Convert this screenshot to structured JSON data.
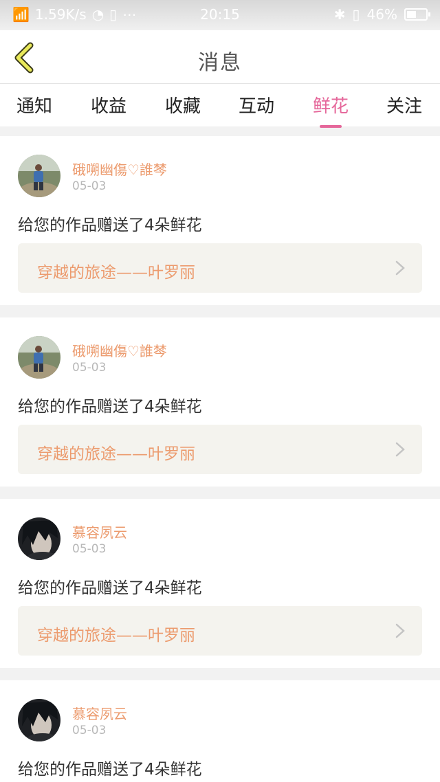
{
  "status_bar": {
    "network_speed": "1.59K/s",
    "time": "20:15",
    "battery": "46%"
  },
  "header": {
    "title": "消息"
  },
  "tabs": [
    {
      "label": "通知",
      "active": false
    },
    {
      "label": "收益",
      "active": false
    },
    {
      "label": "收藏",
      "active": false
    },
    {
      "label": "互动",
      "active": false
    },
    {
      "label": "鲜花",
      "active": true
    },
    {
      "label": "关注",
      "active": false
    }
  ],
  "colors": {
    "accent": "#e5679a",
    "username": "#ec9b6e",
    "link_bg": "#f4f3ee"
  },
  "messages": [
    {
      "username": "硪嗍幽傷♡誰棽",
      "date": "05-03",
      "text": "给您的作品赠送了4朵鲜花",
      "work_title": "穿越的旅途——叶罗丽",
      "avatar": "outdoor-photo-avatar"
    },
    {
      "username": "硪嗍幽傷♡誰棽",
      "date": "05-03",
      "text": "给您的作品赠送了4朵鲜花",
      "work_title": "穿越的旅途——叶罗丽",
      "avatar": "outdoor-photo-avatar"
    },
    {
      "username": "慕容夙云",
      "date": "05-03",
      "text": "给您的作品赠送了4朵鲜花",
      "work_title": "穿越的旅途——叶罗丽",
      "avatar": "anime-character-avatar"
    },
    {
      "username": "慕容夙云",
      "date": "05-03",
      "text": "给您的作品赠送了4朵鲜花",
      "work_title": "",
      "avatar": "anime-character-avatar"
    }
  ]
}
